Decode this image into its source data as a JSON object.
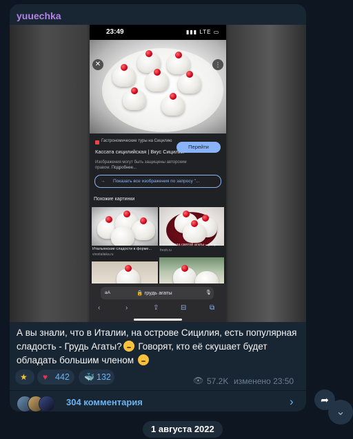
{
  "message": {
    "author": "yuuechka",
    "text": "А вы знали, что в Италии, на острове Сицилия, есть популярная сладость - Грудь Агаты?",
    "text2": " Говорят, кто её скушает будет обладать большим членом",
    "reactions": [
      {
        "icon": "star-icon",
        "count": ""
      },
      {
        "icon": "heart-icon",
        "count": "442"
      },
      {
        "icon": "whale-icon",
        "count": "132"
      }
    ],
    "views": "57.2K",
    "edited": "изменено 23:50",
    "comments_label": "304 комментария"
  },
  "screenshot": {
    "time": "23:49",
    "signal": "LTE",
    "source_site": "Гастрономические туры на Сицилию",
    "source_title": "Кассата сицилийская | Вкус Сицилии",
    "visit_button": "Перейти",
    "copyright_text": "Изображения могут быть защищены авторским правом.",
    "copyright_more": "Подробнее...",
    "show_all": "Показать все изображения по запросу \"...",
    "similar_title": "Похожие картинки",
    "thumb1_caption": "Итальянские сладости в форме...",
    "thumb1_source": "vinoitaliaka.ru",
    "thumb2_caption": "Кассателла святой агаты – реце...",
    "thumb2_source": "fresh.ru",
    "url_prefix": "aA",
    "url": "грудь агаты"
  },
  "date_separator": "1 августа 2022",
  "colors": {
    "background": "#0e1621",
    "bubble": "#182533",
    "author": "#b184e6",
    "link": "#6ab3f3",
    "meta": "#6d7f8f"
  }
}
